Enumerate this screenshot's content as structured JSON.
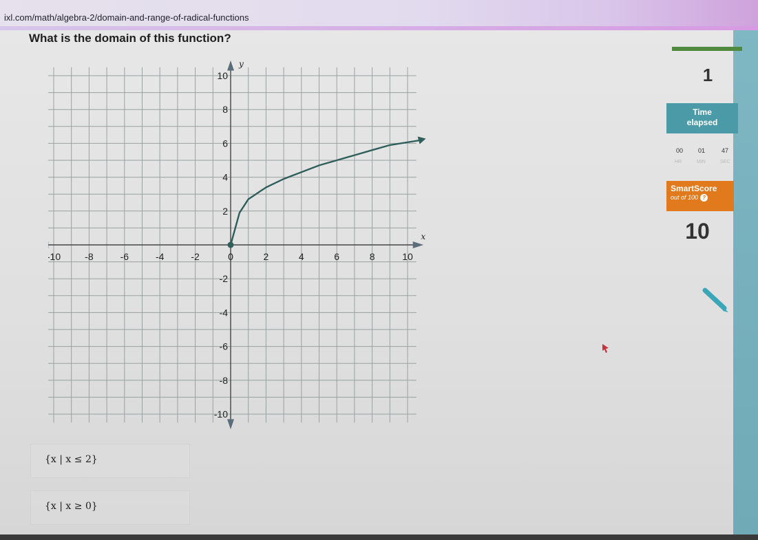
{
  "browser": {
    "url": "ixl.com/math/algebra-2/domain-and-range-of-radical-functions"
  },
  "question": {
    "text": "What is the domain of this function?"
  },
  "graph": {
    "x_axis_label": "x",
    "y_axis_label": "y",
    "x_tick_labels": [
      "-10",
      "-8",
      "-6",
      "-4",
      "-2",
      "0",
      "2",
      "4",
      "6",
      "8",
      "10"
    ],
    "y_tick_labels": [
      "10",
      "8",
      "6",
      "4",
      "2",
      "-2",
      "-4",
      "-6",
      "-8",
      "-10"
    ],
    "grid_color": "#9aa1a1",
    "curve_color": "#2f5f5a"
  },
  "chart_data": {
    "type": "line",
    "title": "",
    "xlabel": "x",
    "ylabel": "y",
    "xlim": [
      -10,
      10
    ],
    "ylim": [
      -10,
      10
    ],
    "grid": true,
    "series": [
      {
        "x": [
          0,
          0.5,
          1,
          2,
          3,
          4,
          5,
          6,
          7,
          8,
          9,
          10.8
        ],
        "y": [
          0,
          1.9,
          2.7,
          3.4,
          3.9,
          4.3,
          4.7,
          5.0,
          5.3,
          5.6,
          5.9,
          6.2
        ]
      }
    ],
    "points": [
      {
        "x": 0,
        "y": 0,
        "filled": true
      }
    ]
  },
  "answers": [
    {
      "label": "{x | x ≤ 2}"
    },
    {
      "label": "{x | x ≥ 0}"
    }
  ],
  "sidebar": {
    "question_number": "1",
    "time_title_1": "Time",
    "time_title_2": "elapsed",
    "time": {
      "hr": "00",
      "min": "01",
      "sec": "47"
    },
    "time_labels": {
      "hr": "HR",
      "min": "MIN",
      "sec": "SEC"
    },
    "smartscore_title": "SmartScore",
    "smartscore_sub": "out of 100",
    "smartscore_help": "?",
    "smartscore_value": "10"
  },
  "colors": {
    "accent_green": "#4f8a3f",
    "time_box": "#4b9aa8",
    "score_box": "#e07a1c",
    "pencil": "#3aa6b8"
  }
}
